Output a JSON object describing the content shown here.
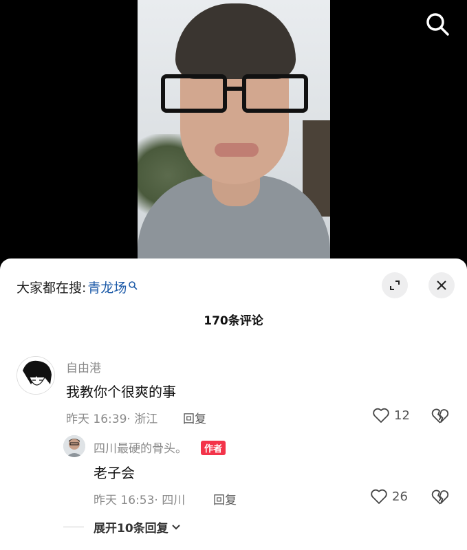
{
  "search_hint": {
    "prefix": "大家都在搜:",
    "keyword": "青龙场"
  },
  "comments_header": {
    "count_label": "170条评论"
  },
  "comment": {
    "username": "自由港",
    "text": "我教你个很爽的事",
    "time": "昨天 16:39",
    "location": "· 浙江",
    "reply_label": "回复",
    "likes": "12"
  },
  "reply": {
    "username": "四川最硬的骨头。",
    "badge": "作者",
    "text": "老子会",
    "time": "昨天 16:53",
    "location": "· 四川",
    "reply_label": "回复",
    "likes": "26"
  },
  "expand_replies_label": "展开10条回复",
  "icons": {
    "search": "search-icon",
    "expand": "expand-icon",
    "close": "close-icon",
    "like": "heart-outline-icon",
    "dislike": "broken-heart-icon",
    "chevron": "chevron-down-icon"
  }
}
